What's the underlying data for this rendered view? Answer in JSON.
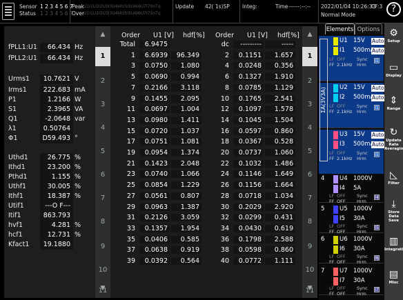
{
  "top": {
    "sensor_label": "Sensor",
    "status_label": "Status",
    "sensor_channels": [
      "1",
      "2",
      "3",
      "4",
      "5",
      "6",
      "7"
    ],
    "peak_label": "Peak",
    "over_label": "Over",
    "peak_codes": [
      "U1",
      "I1",
      "U2",
      "I2",
      "U3",
      "I3",
      "U4",
      "I4",
      "U5",
      "I5",
      "U6",
      "I6",
      "U7",
      "I7",
      "Sn",
      "Tq"
    ],
    "over_codes": [
      "U1",
      "I1",
      "U2",
      "I2",
      "U3",
      "I3",
      "U4",
      "I4",
      "U5",
      "I5",
      "U6",
      "I6",
      "U7",
      "I7",
      "Sn",
      "Tq"
    ],
    "update_label": "Update",
    "update_value": "42( 1s)SP",
    "integ_label": "Integ:",
    "time_label": "Time",
    "time_value": "------:--:--",
    "datetime": "2022/01/04 10:26:33",
    "cf": "CF:3",
    "mode": "Normal Mode",
    "help_icon": "?"
  },
  "left_panel": {
    "items": [
      {
        "label": "fPLL1:U1",
        "value": "66.434",
        "unit": "Hz"
      },
      {
        "label": "fPLL2:U1",
        "value": "66.434",
        "unit": "Hz"
      },
      {
        "label": "Urms1",
        "value": "10.7621",
        "unit": "V"
      },
      {
        "label": "Irms1",
        "value": "222.683",
        "unit": "mA"
      },
      {
        "label": "P1",
        "value": "1.2166",
        "unit": "W"
      },
      {
        "label": "S1",
        "value": "2.3965",
        "unit": "VA"
      },
      {
        "label": "Q1",
        "value": "-2.0648",
        "unit": "var"
      },
      {
        "label": "λ1",
        "value": "0.50764",
        "unit": ""
      },
      {
        "label": "Φ1",
        "value": "D59.493",
        "unit": "°"
      },
      {
        "label": "Uthd1",
        "value": "26.775",
        "unit": "%"
      },
      {
        "label": "Ithd1",
        "value": "23.200",
        "unit": "%"
      },
      {
        "label": "Pthd1",
        "value": "1.155",
        "unit": "%"
      },
      {
        "label": "Uthf1",
        "value": "30.005",
        "unit": "%"
      },
      {
        "label": "Ithf1",
        "value": "18.387",
        "unit": "%"
      },
      {
        "label": "Utif1",
        "value": "---O F---",
        "unit": ""
      },
      {
        "label": "Itif1",
        "value": "863.793",
        "unit": ""
      },
      {
        "label": "hvf1",
        "value": "4.281",
        "unit": "%"
      },
      {
        "label": "hcf1",
        "value": "12.731",
        "unit": "%"
      },
      {
        "label": "Kfact1",
        "value": "19.1880",
        "unit": ""
      }
    ]
  },
  "scroll1": {
    "up": "▲",
    "down": "▼",
    "pages": [
      "1",
      "2",
      "3",
      "4",
      "5",
      "6",
      "7",
      "8",
      "9",
      "10",
      "11"
    ],
    "current": "1"
  },
  "scroll2": {
    "up": "▲",
    "down": "▼",
    "pages": [
      "1",
      "2",
      "3",
      "4",
      "5",
      "6",
      "7",
      "8",
      "9",
      "10",
      "11"
    ],
    "current": "1"
  },
  "table": {
    "headers": {
      "order": "Order",
      "u": "U1 [V]",
      "hdf": "hdf[%]"
    },
    "left": [
      [
        "Total",
        "6.9475",
        ""
      ],
      [
        "1",
        "6.6939",
        "96.349"
      ],
      [
        "3",
        "0.0750",
        "1.080"
      ],
      [
        "5",
        "0.0690",
        "0.994"
      ],
      [
        "7",
        "0.2166",
        "3.118"
      ],
      [
        "9",
        "0.1455",
        "2.095"
      ],
      [
        "11",
        "0.0697",
        "1.004"
      ],
      [
        "13",
        "0.0980",
        "1.411"
      ],
      [
        "15",
        "0.0720",
        "1.037"
      ],
      [
        "17",
        "0.0751",
        "1.081"
      ],
      [
        "19",
        "0.0954",
        "1.374"
      ],
      [
        "21",
        "0.1423",
        "2.048"
      ],
      [
        "23",
        "0.0740",
        "1.066"
      ],
      [
        "25",
        "0.0854",
        "1.229"
      ],
      [
        "27",
        "0.0561",
        "0.807"
      ],
      [
        "29",
        "0.0963",
        "1.387"
      ],
      [
        "31",
        "0.2126",
        "3.059"
      ],
      [
        "33",
        "0.1357",
        "1.954"
      ],
      [
        "35",
        "0.0406",
        "0.585"
      ],
      [
        "37",
        "0.0638",
        "0.919"
      ],
      [
        "39",
        "0.0392",
        "0.564"
      ]
    ],
    "right": [
      [
        "dc",
        "---------",
        "-----"
      ],
      [
        "2",
        "0.1151",
        "1.657"
      ],
      [
        "4",
        "0.0248",
        "0.356"
      ],
      [
        "6",
        "0.1327",
        "1.910"
      ],
      [
        "8",
        "0.0785",
        "1.129"
      ],
      [
        "10",
        "0.1765",
        "2.541"
      ],
      [
        "12",
        "0.1097",
        "1.578"
      ],
      [
        "14",
        "0.1045",
        "1.504"
      ],
      [
        "16",
        "0.0597",
        "0.860"
      ],
      [
        "18",
        "0.0367",
        "0.528"
      ],
      [
        "20",
        "0.0737",
        "1.060"
      ],
      [
        "22",
        "0.1032",
        "1.486"
      ],
      [
        "24",
        "0.1146",
        "1.649"
      ],
      [
        "26",
        "0.1156",
        "1.664"
      ],
      [
        "28",
        "0.0718",
        "1.034"
      ],
      [
        "30",
        "0.2029",
        "2.920"
      ],
      [
        "32",
        "0.0299",
        "0.431"
      ],
      [
        "34",
        "0.0430",
        "0.619"
      ],
      [
        "36",
        "0.1798",
        "2.588"
      ],
      [
        "38",
        "0.0598",
        "0.860"
      ],
      [
        "40",
        "0.0772",
        "1.111"
      ]
    ]
  },
  "elements": {
    "tab_elements": "Elements",
    "tab_options": "Options",
    "sigma_label": "ΣA(3V3A)",
    "groups": [
      {
        "num": "",
        "u": "U1",
        "u_range": "15V",
        "i": "I1",
        "i_range": "500mA",
        "auto": "Auto",
        "lf": "LF",
        "ff": "FF",
        "lf_val": "OFF",
        "ff_val": "2.1kHz",
        "sync": "Sync",
        "src": "Hrm",
        "sb": "I1",
        "color": "#e8e800"
      },
      {
        "num": "",
        "u": "U2",
        "u_range": "15V",
        "i": "I2",
        "i_range": "500mA",
        "auto": "Auto",
        "lf": "LF",
        "ff": "FF",
        "lf_val": "OFF",
        "ff_val": "2.1kHz",
        "sync": "Sync",
        "src": "Hrm",
        "sb": "I1",
        "color": "#00d0f0"
      },
      {
        "num": "",
        "u": "U3",
        "u_range": "15V",
        "i": "I3",
        "i_range": "500mA",
        "auto": "Auto",
        "lf": "LF",
        "ff": "FF",
        "lf_val": "OFF",
        "ff_val": "2.1kHz",
        "sync": "Sync",
        "src": "Hrm",
        "sb": "I1",
        "color": "#ff5080"
      },
      {
        "num": "4",
        "u": "U4",
        "u_range": "1000V",
        "i": "I4",
        "i_range": "5A",
        "auto": "",
        "lf": "LF",
        "ff": "FF",
        "lf_val": "OFF",
        "ff_val": "OFF",
        "sync": "Sync",
        "src": "Hrm",
        "sb": "I4",
        "color": "#b090ff"
      },
      {
        "num": "5",
        "u": "U5",
        "u_range": "1000V",
        "i": "I5",
        "i_range": "30A",
        "auto": "",
        "lf": "LF",
        "ff": "FF",
        "lf_val": "OFF",
        "ff_val": "OFF",
        "sync": "Sync",
        "src": "Hrm",
        "sb": "I5",
        "color": "#4040ff"
      },
      {
        "num": "6",
        "u": "U6",
        "u_range": "1000V",
        "i": "I6",
        "i_range": "30A",
        "auto": "",
        "lf": "LF",
        "ff": "FF",
        "lf_val": "OFF",
        "ff_val": "OFF",
        "sync": "Sync",
        "src": "Hrm",
        "sb": "I6",
        "color": "#d0d000"
      },
      {
        "num": "7",
        "u": "U7",
        "u_range": "1000V",
        "i": "I7",
        "i_range": "30A",
        "auto": "",
        "lf": "LF",
        "ff": "FF",
        "lf_val": "OFF",
        "ff_val": "OFF",
        "sync": "Sync",
        "src": "Hrm",
        "sb": "I7",
        "color": "#ff6060"
      }
    ]
  },
  "sidebar": [
    {
      "label": "Setup",
      "icon": "gear-icon",
      "glyph": "⚙"
    },
    {
      "label": "Display",
      "icon": "display-icon",
      "glyph": "▭"
    },
    {
      "label": "Range",
      "icon": "range-icon",
      "glyph": "⇕"
    },
    {
      "label": "Update Rate Averaging",
      "icon": "refresh-icon",
      "glyph": "↻"
    },
    {
      "label": "Filter",
      "icon": "filter-icon",
      "glyph": "◺"
    },
    {
      "label": "Store Data Save",
      "icon": "download-icon",
      "glyph": "⤓"
    },
    {
      "label": "Integration",
      "icon": "integration-icon",
      "glyph": "▥"
    },
    {
      "label": "Misc",
      "icon": "toolbox-icon",
      "glyph": "▤"
    }
  ]
}
